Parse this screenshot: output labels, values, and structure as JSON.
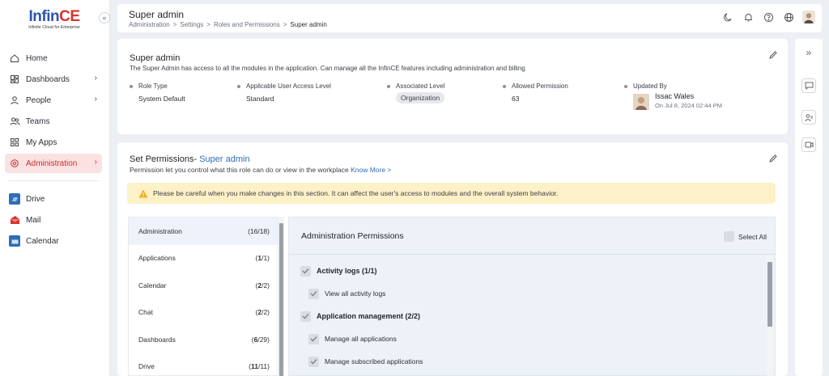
{
  "logo": {
    "part1": "Infin",
    "part2": "CE",
    "tagline": "Infinite Cloud for Enterprise"
  },
  "sidebar": {
    "collapse_glyph": "«",
    "items": [
      {
        "label": "Home",
        "icon": "home-icon",
        "has_chevron": false,
        "active": false
      },
      {
        "label": "Dashboards",
        "icon": "dashboards-icon",
        "has_chevron": true,
        "active": false
      },
      {
        "label": "People",
        "icon": "people-icon",
        "has_chevron": true,
        "active": false
      },
      {
        "label": "Teams",
        "icon": "teams-icon",
        "has_chevron": false,
        "active": false
      },
      {
        "label": "My Apps",
        "icon": "apps-icon",
        "has_chevron": false,
        "active": false
      },
      {
        "label": "Administration",
        "icon": "admin-gear-icon",
        "has_chevron": true,
        "active": true
      }
    ],
    "apps": [
      {
        "label": "Drive",
        "icon": "drive-icon",
        "color": "#2f6db5"
      },
      {
        "label": "Mail",
        "icon": "mail-icon",
        "color": "#d9312c"
      },
      {
        "label": "Calendar",
        "icon": "calendar-icon",
        "color": "#2f6db5"
      }
    ]
  },
  "header": {
    "title": "Super admin",
    "breadcrumb": [
      "Administration",
      "Settings",
      "Roles and Permissions",
      "Super admin"
    ],
    "icons": [
      "moon-icon",
      "bell-icon",
      "help-icon",
      "globe-icon",
      "user-avatar"
    ]
  },
  "role": {
    "name": "Super admin",
    "description": "The Super Admin has access to all the modules in the application. Can manage all the InfinCE features including administration and billing",
    "role_type_label": "Role Type",
    "role_type_value": "System Default",
    "access_label": "Applicable User Access Level",
    "access_value": "Standard",
    "assoc_label": "Associated Level",
    "assoc_value": "Organization",
    "allowed_label": "Allowed Permission",
    "allowed_value": "63",
    "updated_label": "Updated By",
    "updated_name": "Issac Wales",
    "updated_date": "On Jul 8, 2024 02:44 PM"
  },
  "permissions": {
    "title_prefix": "Set Permissions- ",
    "title_role": "Super admin",
    "subtitle": "Permission let you control what this role can do or view in the workplace ",
    "know_more": "Know More >",
    "warning": "Please be careful when you make changes in this section. It can affect the user's access to modules and the overall system behavior.",
    "categories": [
      {
        "name": "Administration",
        "count": "(16/18)",
        "selected": true
      },
      {
        "name": "Applications",
        "count_open": "(",
        "count_done": "1",
        "count_rest": "/1)",
        "selected": false
      },
      {
        "name": "Calendar",
        "count_open": "(",
        "count_done": "2",
        "count_rest": "/2)",
        "selected": false
      },
      {
        "name": "Chat",
        "count_open": "(",
        "count_done": "2",
        "count_rest": "/2)",
        "selected": false
      },
      {
        "name": "Dashboards",
        "count_open": "(",
        "count_done": "6",
        "count_rest": "/29)",
        "selected": false
      },
      {
        "name": "Drive",
        "count_open": "(",
        "count_done": "11",
        "count_rest": "/11)",
        "selected": false
      }
    ],
    "panel_title": "Administration Permissions",
    "select_all": "Select All",
    "rows": [
      {
        "label": "Activity logs (1/1)",
        "group": true
      },
      {
        "label": "View all activity logs",
        "group": false
      },
      {
        "label": "Application management (2/2)",
        "group": true
      },
      {
        "label": "Manage all applications",
        "group": false
      },
      {
        "label": "Manage subscribed applications",
        "group": false
      }
    ]
  },
  "rail": {
    "expand_glyph": "»",
    "icons": [
      "chat-bubble-icon",
      "contacts-icon",
      "video-call-icon"
    ]
  }
}
